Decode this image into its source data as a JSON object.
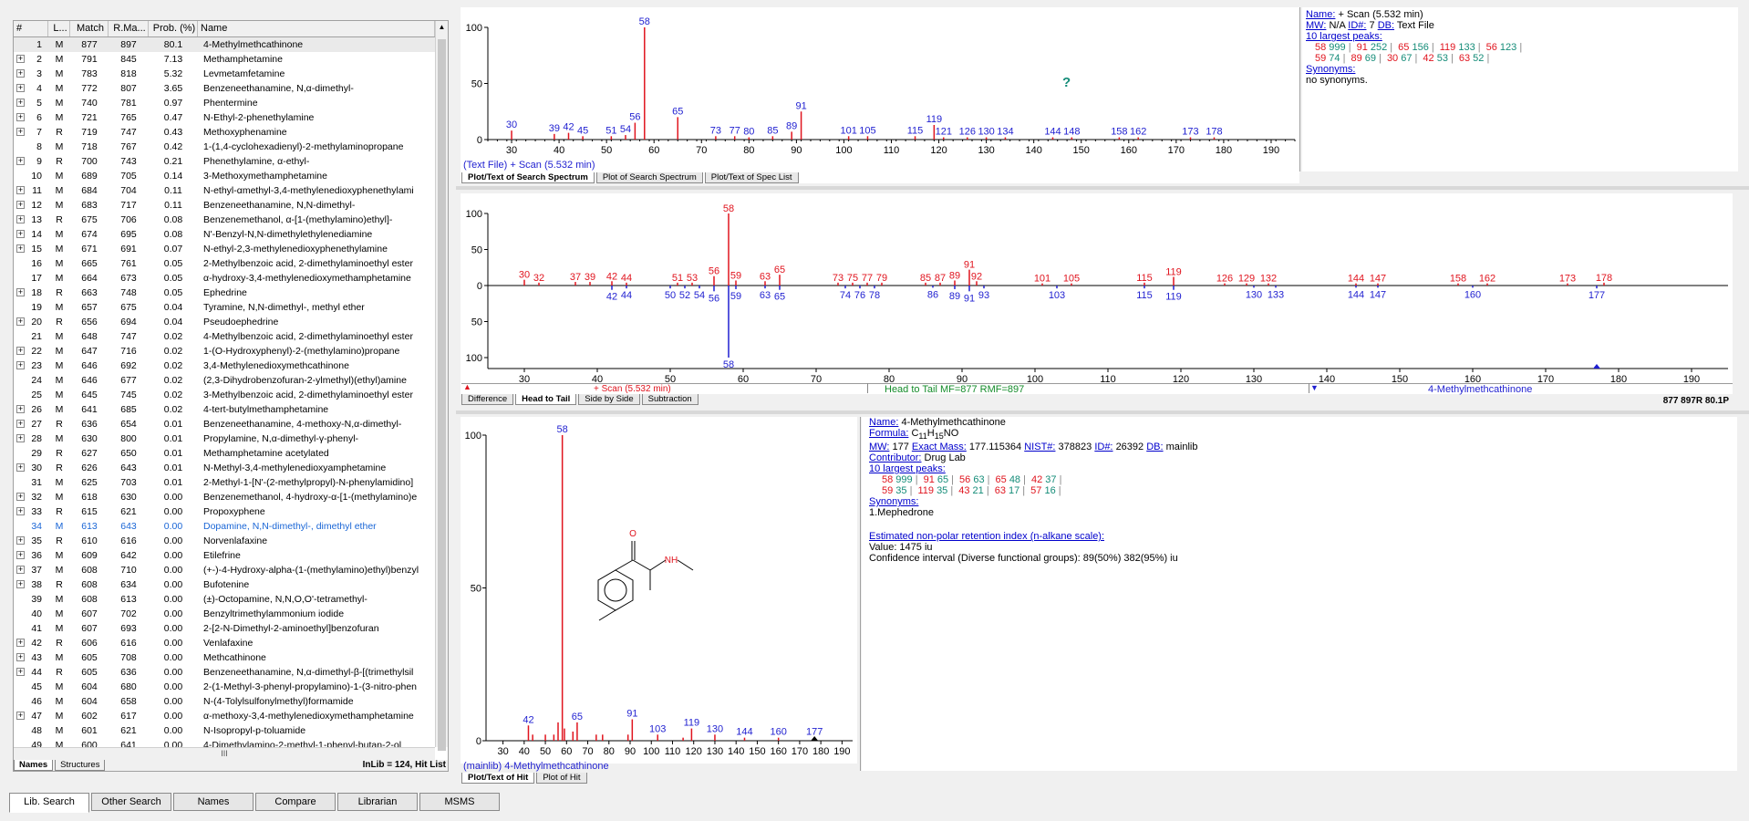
{
  "hitlist": {
    "headers": [
      "#",
      "L...",
      "Match",
      "R.Ma...",
      "Prob. (%)",
      "Name"
    ],
    "rows": [
      [
        "1",
        "",
        "M",
        "877",
        "897",
        "80.1",
        "4-Methylmethcathinone"
      ],
      [
        "2",
        "+",
        "M",
        "791",
        "845",
        "7.13",
        "Methamphetamine"
      ],
      [
        "3",
        "+",
        "M",
        "783",
        "818",
        "5.32",
        "Levmetamfetamine"
      ],
      [
        "4",
        "+",
        "M",
        "772",
        "807",
        "3.65",
        "Benzeneethanamine, N,α-dimethyl-"
      ],
      [
        "5",
        "+",
        "M",
        "740",
        "781",
        "0.97",
        "Phentermine"
      ],
      [
        "6",
        "+",
        "M",
        "721",
        "765",
        "0.47",
        "N-Ethyl-2-phenethylamine"
      ],
      [
        "7",
        "+",
        "R",
        "719",
        "747",
        "0.43",
        "Methoxyphenamine"
      ],
      [
        "8",
        "",
        "M",
        "718",
        "767",
        "0.42",
        "1-(1,4-cyclohexadienyl)-2-methylaminopropane"
      ],
      [
        "9",
        "+",
        "R",
        "700",
        "743",
        "0.21",
        "Phenethylamine, α-ethyl-"
      ],
      [
        "10",
        "",
        "M",
        "689",
        "705",
        "0.14",
        "3-Methoxymethamphetamine"
      ],
      [
        "11",
        "+",
        "M",
        "684",
        "704",
        "0.11",
        "N-ethyl-αmethyl-3,4-methylenedioxyphenethylami"
      ],
      [
        "12",
        "+",
        "M",
        "683",
        "717",
        "0.11",
        "Benzeneethanamine, N,N-dimethyl-"
      ],
      [
        "13",
        "+",
        "R",
        "675",
        "706",
        "0.08",
        "Benzenemethanol, α-[1-(methylamino)ethyl]-"
      ],
      [
        "14",
        "+",
        "M",
        "674",
        "695",
        "0.08",
        "N'-Benzyl-N,N-dimethylethylenediamine"
      ],
      [
        "15",
        "+",
        "M",
        "671",
        "691",
        "0.07",
        "N-ethyl-2,3-methylenedioxyphenethylamine"
      ],
      [
        "16",
        "",
        "M",
        "665",
        "761",
        "0.05",
        "2-Methylbenzoic acid, 2-dimethylaminoethyl ester"
      ],
      [
        "17",
        "",
        "M",
        "664",
        "673",
        "0.05",
        "α-hydroxy-3,4-methylenedioxymethamphetamine"
      ],
      [
        "18",
        "+",
        "R",
        "663",
        "748",
        "0.05",
        "Ephedrine"
      ],
      [
        "19",
        "",
        "M",
        "657",
        "675",
        "0.04",
        "Tyramine, N,N-dimethyl-, methyl ether"
      ],
      [
        "20",
        "+",
        "R",
        "656",
        "694",
        "0.04",
        "Pseudoephedrine"
      ],
      [
        "21",
        "",
        "M",
        "648",
        "747",
        "0.02",
        "4-Methylbenzoic acid, 2-dimethylaminoethyl ester"
      ],
      [
        "22",
        "+",
        "M",
        "647",
        "716",
        "0.02",
        "1-(O-Hydroxyphenyl)-2-(methylamino)propane"
      ],
      [
        "23",
        "+",
        "M",
        "646",
        "692",
        "0.02",
        "3,4-Methylenedioxymethcathinone"
      ],
      [
        "24",
        "",
        "M",
        "646",
        "677",
        "0.02",
        "(2,3-Dihydrobenzofuran-2-ylmethyl)(ethyl)amine"
      ],
      [
        "25",
        "",
        "M",
        "645",
        "745",
        "0.02",
        "3-Methylbenzoic acid, 2-dimethylaminoethyl ester"
      ],
      [
        "26",
        "+",
        "M",
        "641",
        "685",
        "0.02",
        "4-tert-butylmethamphetamine"
      ],
      [
        "27",
        "+",
        "R",
        "636",
        "654",
        "0.01",
        "Benzeneethanamine, 4-methoxy-N,α-dimethyl-"
      ],
      [
        "28",
        "+",
        "M",
        "630",
        "800",
        "0.01",
        "Propylamine, N,α-dimethyl-γ-phenyl-"
      ],
      [
        "29",
        "",
        "R",
        "627",
        "650",
        "0.01",
        "Methamphetamine acetylated"
      ],
      [
        "30",
        "+",
        "R",
        "626",
        "643",
        "0.01",
        "N-Methyl-3,4-methylenedioxyamphetamine"
      ],
      [
        "31",
        "",
        "M",
        "625",
        "703",
        "0.01",
        "2-Methyl-1-[N'-(2-methylpropyl)-N-phenylamidino]"
      ],
      [
        "32",
        "+",
        "M",
        "618",
        "630",
        "0.00",
        "Benzenemethanol, 4-hydroxy-α-[1-(methylamino)e"
      ],
      [
        "33",
        "+",
        "R",
        "615",
        "621",
        "0.00",
        "Propoxyphene"
      ],
      [
        "34",
        "",
        "M",
        "613",
        "643",
        "0.00",
        "Dopamine, N,N-dimethyl-, dimethyl ether"
      ],
      [
        "35",
        "+",
        "R",
        "610",
        "616",
        "0.00",
        "Norvenlafaxine"
      ],
      [
        "36",
        "+",
        "M",
        "609",
        "642",
        "0.00",
        "Etilefrine"
      ],
      [
        "37",
        "+",
        "M",
        "608",
        "710",
        "0.00",
        "(+-)-4-Hydroxy-alpha-(1-(methylamino)ethyl)benzyl"
      ],
      [
        "38",
        "+",
        "R",
        "608",
        "634",
        "0.00",
        "Bufotenine"
      ],
      [
        "39",
        "",
        "M",
        "608",
        "613",
        "0.00",
        "(±)-Octopamine, N,N,O,O'-tetramethyl-"
      ],
      [
        "40",
        "",
        "M",
        "607",
        "702",
        "0.00",
        "Benzyltrimethylammonium iodide"
      ],
      [
        "41",
        "",
        "M",
        "607",
        "693",
        "0.00",
        "2-[2-N-Dimethyl-2-aminoethyl]benzofuran"
      ],
      [
        "42",
        "+",
        "R",
        "606",
        "616",
        "0.00",
        "Venlafaxine"
      ],
      [
        "43",
        "+",
        "M",
        "605",
        "708",
        "0.00",
        "Methcathinone"
      ],
      [
        "44",
        "+",
        "R",
        "605",
        "636",
        "0.00",
        "Benzeneethanamine, N,α-dimethyl-β-[(trimethylsil"
      ],
      [
        "45",
        "",
        "M",
        "604",
        "680",
        "0.00",
        "2-(1-Methyl-3-phenyl-propylamino)-1-(3-nitro-phen"
      ],
      [
        "46",
        "",
        "M",
        "604",
        "658",
        "0.00",
        "N-(4-Tolylsulfonylmethyl)formamide"
      ],
      [
        "47",
        "+",
        "M",
        "602",
        "617",
        "0.00",
        "α-methoxy-3,4-methylenedioxymethamphetamine"
      ],
      [
        "48",
        "",
        "M",
        "601",
        "621",
        "0.00",
        "N-Isopropyl-p-toluamide"
      ],
      [
        "49",
        "",
        "M",
        "600",
        "641",
        "0.00",
        "4-Dimethylamino-2-methyl-1-phenyl-butan-2-ol"
      ]
    ],
    "hscroll_label": "III",
    "tabs": [
      "Names",
      "Structures"
    ],
    "inlib": "InLib = 124, Hit List"
  },
  "search_spectrum": {
    "caption": "(Text File) + Scan (5.532 min)",
    "tabs": [
      "Plot/Text of Search Spectrum",
      "Plot of Search Spectrum",
      "Plot/Text of Spec List"
    ],
    "help_glyph": "?",
    "x_ticks": [
      30,
      40,
      50,
      60,
      70,
      80,
      90,
      100,
      110,
      120,
      130,
      140,
      150,
      160,
      170,
      180,
      190
    ],
    "y_ticks": [
      0,
      50,
      100
    ],
    "chart_data": {
      "type": "bar",
      "title": "",
      "xlabel": "m/z",
      "ylabel": "",
      "xlim": [
        25,
        195
      ],
      "ylim": [
        0,
        100
      ],
      "peaks": [
        [
          30,
          8
        ],
        [
          39,
          5
        ],
        [
          42,
          6
        ],
        [
          45,
          3
        ],
        [
          51,
          3
        ],
        [
          54,
          4
        ],
        [
          56,
          15
        ],
        [
          58,
          100
        ],
        [
          65,
          20
        ],
        [
          73,
          3
        ],
        [
          77,
          3
        ],
        [
          80,
          2
        ],
        [
          85,
          3
        ],
        [
          89,
          7
        ],
        [
          91,
          25
        ],
        [
          101,
          3
        ],
        [
          105,
          3
        ],
        [
          115,
          3
        ],
        [
          119,
          13
        ],
        [
          121,
          2
        ],
        [
          126,
          2
        ],
        [
          130,
          2
        ],
        [
          134,
          2
        ],
        [
          144,
          2
        ],
        [
          148,
          2
        ],
        [
          158,
          2
        ],
        [
          162,
          2
        ],
        [
          173,
          2
        ],
        [
          178,
          2
        ]
      ]
    }
  },
  "search_info": {
    "name_label": "Name:",
    "name": "+ Scan (5.532 min)",
    "mw_label": "MW:",
    "mw": "N/A",
    "id_label": "ID#:",
    "id": "7",
    "db_label": "DB:",
    "db": "Text File",
    "peaks_label": "10 largest peaks:",
    "peaks_row1": [
      [
        "58",
        "999"
      ],
      [
        "91",
        "252"
      ],
      [
        "65",
        "156"
      ],
      [
        "119",
        "133"
      ],
      [
        "56",
        "123"
      ]
    ],
    "peaks_row2": [
      [
        "59",
        "74"
      ],
      [
        "89",
        "69"
      ],
      [
        "30",
        "67"
      ],
      [
        "42",
        "53"
      ],
      [
        "63",
        "52"
      ]
    ],
    "synonyms_label": "Synonyms:",
    "synonyms": "no synonyms."
  },
  "head_to_tail": {
    "x_ticks": [
      30,
      40,
      50,
      60,
      70,
      80,
      90,
      100,
      110,
      120,
      130,
      140,
      150,
      160,
      170,
      180,
      190
    ],
    "y_ticks": [
      "100",
      "50",
      "0",
      "50",
      "100"
    ],
    "tabs": [
      "Difference",
      "Head to Tail",
      "Side by Side",
      "Subtraction"
    ],
    "bar_left": "+ Scan (5.532 min)",
    "bar_mid": "Head to Tail MF=877 RMF=897",
    "bar_right": "4-Methylmethcathinone",
    "score": "877 897R 80.1P",
    "chart_data": {
      "type": "bar",
      "xlim": [
        25,
        195
      ],
      "ylim": [
        -100,
        100
      ],
      "series": [
        {
          "name": "+ Scan (5.532 min)",
          "peaks": [
            [
              30,
              8
            ],
            [
              32,
              4
            ],
            [
              37,
              5
            ],
            [
              39,
              5
            ],
            [
              42,
              6
            ],
            [
              44,
              4
            ],
            [
              51,
              4
            ],
            [
              53,
              4
            ],
            [
              56,
              13
            ],
            [
              58,
              100
            ],
            [
              59,
              7
            ],
            [
              63,
              6
            ],
            [
              65,
              15
            ],
            [
              73,
              4
            ],
            [
              75,
              4
            ],
            [
              77,
              4
            ],
            [
              79,
              4
            ],
            [
              85,
              4
            ],
            [
              87,
              4
            ],
            [
              89,
              7
            ],
            [
              91,
              22
            ],
            [
              92,
              6
            ],
            [
              101,
              3
            ],
            [
              105,
              3
            ],
            [
              115,
              4
            ],
            [
              119,
              12
            ],
            [
              126,
              3
            ],
            [
              129,
              3
            ],
            [
              132,
              3
            ],
            [
              144,
              3
            ],
            [
              147,
              3
            ],
            [
              158,
              3
            ],
            [
              162,
              3
            ],
            [
              173,
              3
            ],
            [
              178,
              4
            ]
          ]
        },
        {
          "name": "4-Methylmethcathinone",
          "peaks": [
            [
              42,
              -6
            ],
            [
              44,
              -4
            ],
            [
              50,
              -4
            ],
            [
              52,
              -4
            ],
            [
              54,
              -4
            ],
            [
              56,
              -8
            ],
            [
              58,
              -100
            ],
            [
              59,
              -5
            ],
            [
              63,
              -4
            ],
            [
              65,
              -6
            ],
            [
              74,
              -4
            ],
            [
              76,
              -4
            ],
            [
              78,
              -4
            ],
            [
              86,
              -3
            ],
            [
              89,
              -5
            ],
            [
              91,
              -8
            ],
            [
              93,
              -4
            ],
            [
              103,
              -4
            ],
            [
              115,
              -4
            ],
            [
              119,
              -6
            ],
            [
              130,
              -3
            ],
            [
              133,
              -3
            ],
            [
              144,
              -3
            ],
            [
              147,
              -3
            ],
            [
              160,
              -3
            ],
            [
              177,
              -4
            ]
          ]
        }
      ]
    }
  },
  "hit_spectrum": {
    "caption": "(mainlib) 4-Methylmethcathinone",
    "tabs": [
      "Plot/Text of Hit",
      "Plot of Hit"
    ],
    "x_ticks": [
      30,
      40,
      50,
      60,
      70,
      80,
      90,
      100,
      110,
      120,
      130,
      140,
      150,
      160,
      170,
      180,
      190
    ],
    "y_ticks": [
      0,
      50,
      100
    ],
    "structure_labels": {
      "o": "O",
      "nh": "NH"
    },
    "chart_data": {
      "type": "bar",
      "xlim": [
        22,
        195
      ],
      "ylim": [
        0,
        100
      ],
      "peaks": [
        [
          42,
          5
        ],
        [
          44,
          2
        ],
        [
          50,
          2
        ],
        [
          54,
          2
        ],
        [
          56,
          6
        ],
        [
          58,
          100
        ],
        [
          59,
          4
        ],
        [
          63,
          3
        ],
        [
          65,
          6
        ],
        [
          74,
          2
        ],
        [
          77,
          2
        ],
        [
          89,
          2
        ],
        [
          91,
          7
        ],
        [
          103,
          2
        ],
        [
          115,
          1
        ],
        [
          119,
          4
        ],
        [
          130,
          2
        ],
        [
          144,
          1
        ],
        [
          160,
          1
        ],
        [
          177,
          1
        ]
      ]
    }
  },
  "hit_info": {
    "name_label": "Name:",
    "name": "4-Methylmethcathinone",
    "formula_label": "Formula:",
    "formula": "C11H15NO",
    "mw_label": "MW:",
    "mw": "177",
    "exact_label": "Exact Mass:",
    "exact": "177.115364",
    "nist_label": "NIST#:",
    "nist": "378823",
    "id_label": "ID#:",
    "id": "26392",
    "db_label": "DB:",
    "db": "mainlib",
    "contrib_label": "Contributor:",
    "contrib": "Drug Lab",
    "peaks_label": "10 largest peaks:",
    "peaks_row1": [
      [
        "58",
        "999"
      ],
      [
        "91",
        "65"
      ],
      [
        "56",
        "63"
      ],
      [
        "65",
        "48"
      ],
      [
        "42",
        "37"
      ]
    ],
    "peaks_row2": [
      [
        "59",
        "35"
      ],
      [
        "119",
        "35"
      ],
      [
        "43",
        "21"
      ],
      [
        "63",
        "17"
      ],
      [
        "57",
        "16"
      ]
    ],
    "synonyms_label": "Synonyms:",
    "synonyms": "1.Mephedrone",
    "ri_label": "Estimated non-polar retention index (n-alkane scale):",
    "ri_value": "Value: 1475 iu",
    "ri_ci": "Confidence interval (Diverse functional groups):  89(50%) 382(95%) iu"
  },
  "bottom_tabs": [
    "Lib. Search",
    "Other Search",
    "Names",
    "Compare",
    "Librarian",
    "MSMS"
  ],
  "colors": {
    "red": "#e0141e",
    "blue": "#1f1fd0",
    "green": "#148c78"
  }
}
